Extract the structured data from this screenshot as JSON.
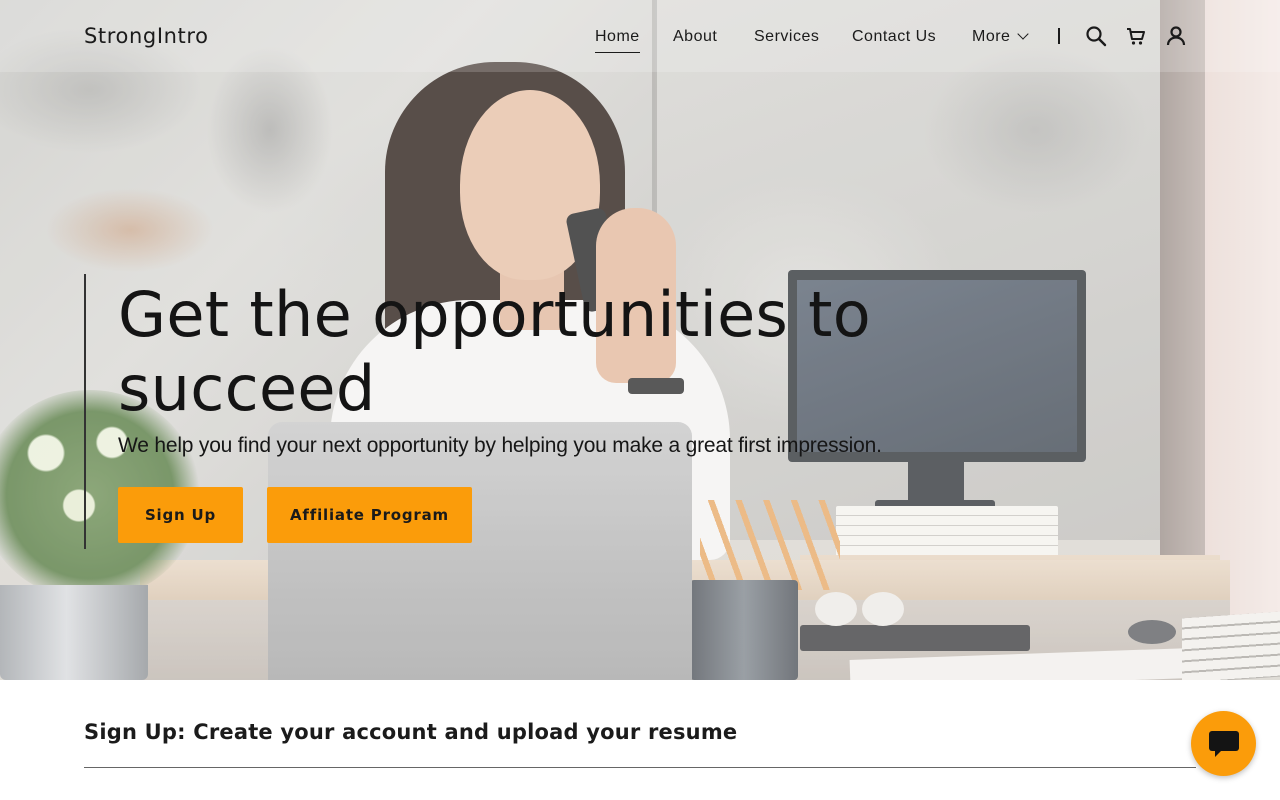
{
  "site": {
    "logo": "StrongIntro"
  },
  "nav": {
    "items": [
      {
        "label": "Home",
        "active": true
      },
      {
        "label": "About"
      },
      {
        "label": "Services"
      },
      {
        "label": "Contact Us"
      },
      {
        "label": "More"
      }
    ],
    "icons": [
      "search-icon",
      "cart-icon",
      "account-icon"
    ]
  },
  "hero": {
    "title": "Get the opportunities to succeed",
    "subtitle": "We help you find your next opportunity by helping you make a great first impression.",
    "primary_button": "Sign Up",
    "secondary_button": "Affiliate Program"
  },
  "section": {
    "heading": "Sign Up: Create your account and upload your resume"
  },
  "chat": {
    "icon": "chat-icon"
  },
  "colors": {
    "accent": "#fb9c0a",
    "text": "#1b1b1b",
    "background": "#ffffff"
  }
}
